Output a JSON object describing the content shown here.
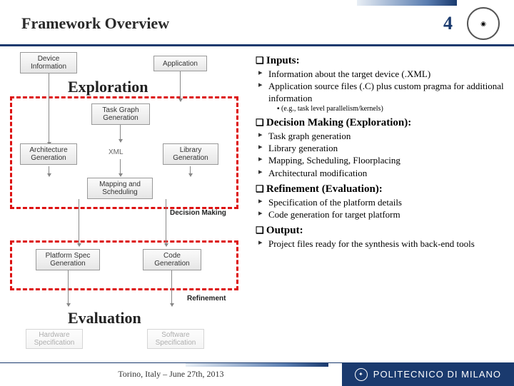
{
  "header": {
    "title": "Framework Overview",
    "page": "4"
  },
  "diagram": {
    "input_left": "Device\nInformation",
    "input_right": "Application",
    "task_graph": "Task Graph\nGeneration",
    "arch_gen": "Architecture\nGeneration",
    "xml": "XML",
    "lib_gen": "Library\nGeneration",
    "mapping": "Mapping and\nScheduling",
    "phase_decision": "Decision Making",
    "platform_spec": "Platform Spec\nGeneration",
    "code_gen": "Code\nGeneration",
    "phase_refine": "Refinement",
    "hw_spec": "Hardware\nSpecification",
    "sw_spec": "Software\nSpecification",
    "label_exploration": "Exploration",
    "label_evaluation": "Evaluation"
  },
  "sections": {
    "inputs": {
      "title": "Inputs:",
      "items": [
        "Information about the target device (.XML)",
        "Application source files (.C) plus custom pragma for additional information"
      ],
      "note": "(e.g., task level parallelism/kernels)"
    },
    "decision": {
      "title": "Decision Making (Exploration):",
      "items": [
        "Task graph generation",
        "Library generation",
        "Mapping, Scheduling, Floorplacing",
        "Architectural modification"
      ]
    },
    "refinement": {
      "title": "Refinement (Evaluation):",
      "items": [
        "Specification of the platform details",
        "Code generation for target platform"
      ]
    },
    "output": {
      "title": "Output:",
      "items": [
        "Project files ready for the synthesis with back-end tools"
      ]
    }
  },
  "footer": {
    "venue": "Torino, Italy – June 27th, 2013",
    "org": "POLITECNICO DI MILANO"
  }
}
